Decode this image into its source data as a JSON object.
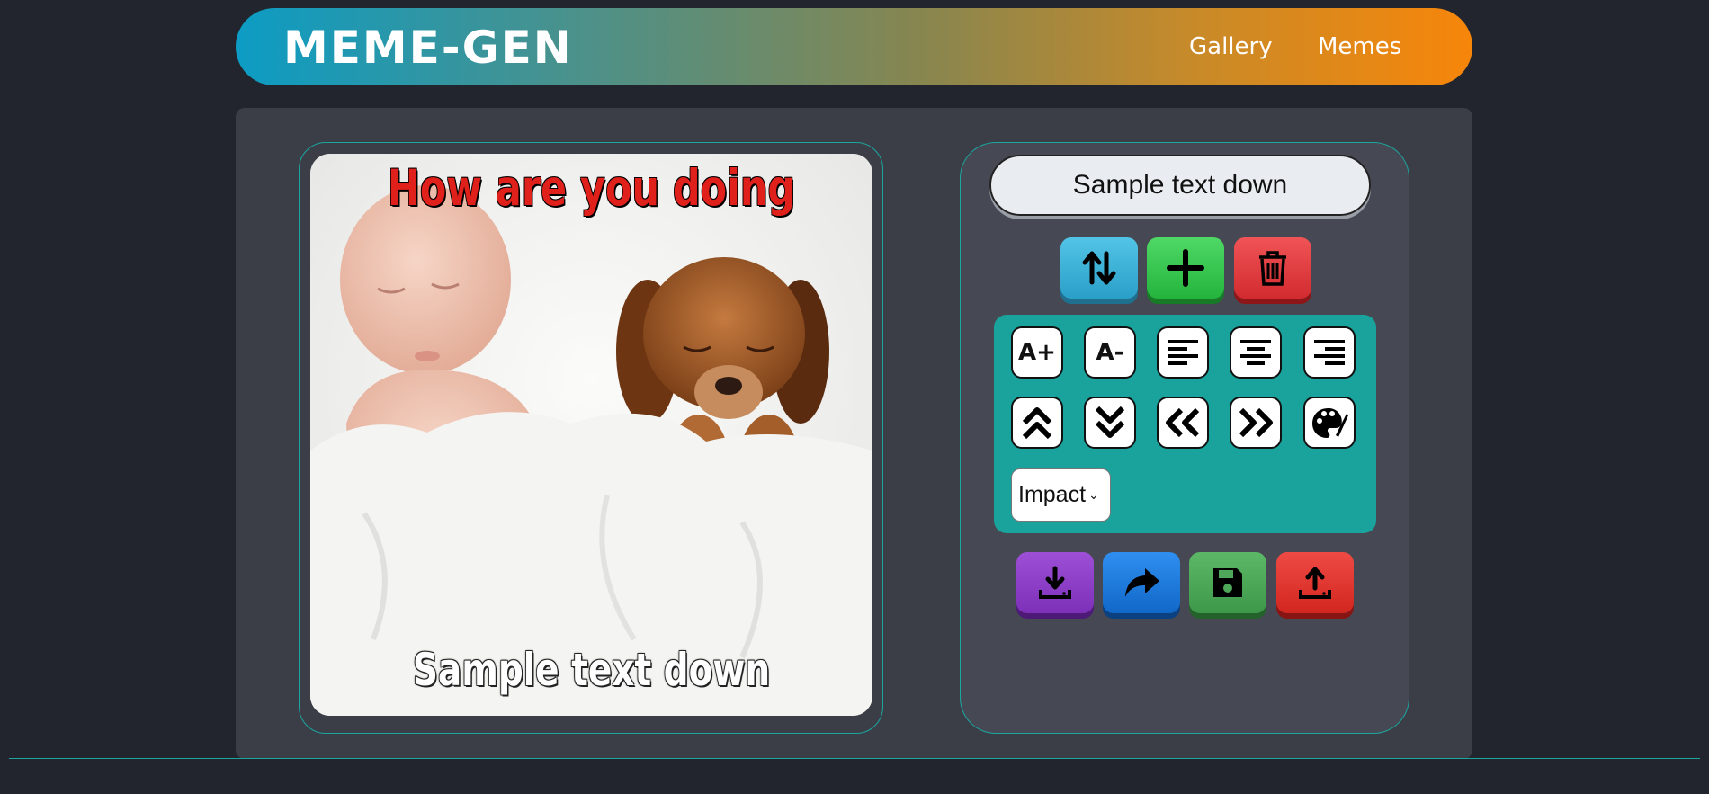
{
  "header": {
    "logo": "MEME-GEN",
    "nav": [
      "Gallery",
      "Memes"
    ]
  },
  "meme": {
    "top_text": "How are you doing",
    "bottom_text": "Sample text down"
  },
  "editor": {
    "text_input_value": "Sample text down",
    "actions": [
      {
        "icon": "swap-lines-icon",
        "color": "#3ab0d6"
      },
      {
        "icon": "plus-icon",
        "color": "#2fc04a"
      },
      {
        "icon": "trash-icon",
        "color": "#e0383b"
      }
    ],
    "tools": [
      {
        "icon": "increase-font-icon",
        "label": "A+"
      },
      {
        "icon": "decrease-font-icon",
        "label": "A-"
      },
      {
        "icon": "align-left-icon"
      },
      {
        "icon": "align-center-icon"
      },
      {
        "icon": "align-right-icon"
      },
      {
        "icon": "move-up-icon"
      },
      {
        "icon": "move-down-icon"
      },
      {
        "icon": "move-left-icon"
      },
      {
        "icon": "move-right-icon"
      },
      {
        "icon": "palette-icon"
      }
    ],
    "font_select": "Impact",
    "bottom_actions": [
      {
        "icon": "download-icon",
        "color": "#8e3fc8"
      },
      {
        "icon": "share-icon",
        "color": "#1f7ee0"
      },
      {
        "icon": "save-icon",
        "color": "#4fa85a"
      },
      {
        "icon": "upload-icon",
        "color": "#e0342f"
      }
    ]
  },
  "colors": {
    "background": "#22252d",
    "panel": "#3b3e47",
    "accent": "#1aa29c"
  }
}
